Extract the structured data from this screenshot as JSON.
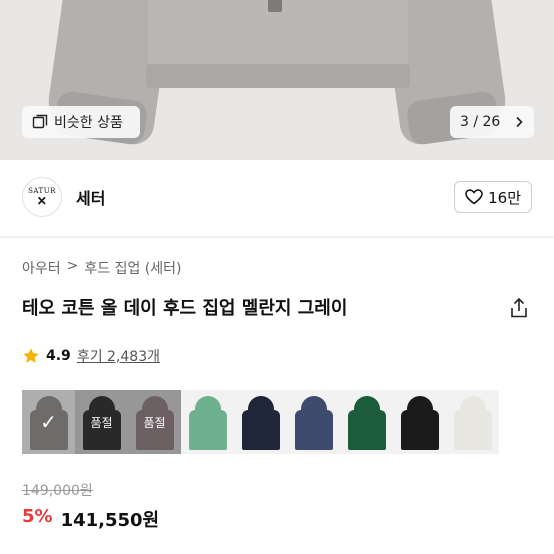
{
  "hero": {
    "similar_label": "비슷한 상품",
    "counter": "3 / 26",
    "colors": {
      "garment": "#b9b8b7",
      "background": "#e9e7e6"
    }
  },
  "brand": {
    "logo_text": "SATUR",
    "name": "세터",
    "likes": "16만"
  },
  "breadcrumb": [
    "아우터",
    ">",
    "후드 집업 (세터)"
  ],
  "product": {
    "title": "테오 코튼 올 데이 후드 집업 멜란지 그레이"
  },
  "rating": {
    "score": "4.9",
    "reviews": "후기 2,483개"
  },
  "swatches": [
    {
      "color": "#8e8d8b",
      "state": "selected",
      "overlay": "✓"
    },
    {
      "color": "#2b2b2b",
      "state": "soldout",
      "overlay": "품절"
    },
    {
      "color": "#a58f92",
      "state": "soldout",
      "overlay": "품절"
    },
    {
      "color": "#6fb08e",
      "state": "available",
      "overlay": ""
    },
    {
      "color": "#1f2638",
      "state": "available",
      "overlay": ""
    },
    {
      "color": "#3e4a6e",
      "state": "available",
      "overlay": ""
    },
    {
      "color": "#1d5c3a",
      "state": "available",
      "overlay": ""
    },
    {
      "color": "#1b1b1b",
      "state": "available",
      "overlay": ""
    },
    {
      "color": "#e9e7e1",
      "state": "available",
      "overlay": ""
    }
  ],
  "price": {
    "original": "149,000원",
    "discount": "5%",
    "final": "141,550원",
    "discount_color": "#e23c3c"
  }
}
